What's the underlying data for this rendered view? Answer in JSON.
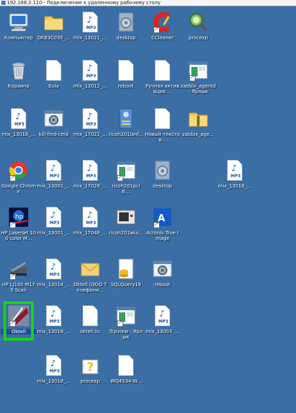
{
  "window": {
    "title": "192.168.2.110 - Подключение к удаленному рабочему столу"
  },
  "desktop": {
    "icons": [
      {
        "label": "Компьютер",
        "type": "computer",
        "col": 0,
        "row": 0
      },
      {
        "label": "OKB3C035_...",
        "type": "folder",
        "col": 1,
        "row": 0
      },
      {
        "label": "mix_13021_...",
        "type": "mp3",
        "col": 2,
        "row": 0
      },
      {
        "label": "desktop",
        "type": "gear",
        "col": 3,
        "row": 0
      },
      {
        "label": "CCleaner",
        "type": "ccleaner",
        "col": 4,
        "row": 0
      },
      {
        "label": "procexp",
        "type": "procexp",
        "col": 5,
        "row": 0
      },
      {
        "label": "Корзина",
        "type": "recycle",
        "col": 0,
        "row": 1
      },
      {
        "label": "Eula",
        "type": "doc",
        "col": 1,
        "row": 1
      },
      {
        "label": "mix_13012_...",
        "type": "mp3",
        "col": 2,
        "row": 1
      },
      {
        "label": "reboot",
        "type": "doc",
        "col": 3,
        "row": 1
      },
      {
        "label": "Ручная активация ...",
        "type": "doc",
        "col": 4,
        "row": 1
      },
      {
        "label": "zabbix_agentd - Ярлык",
        "type": "window",
        "col": 5,
        "row": 1
      },
      {
        "label": "mix_13018_...",
        "type": "mp3",
        "col": 0,
        "row": 2
      },
      {
        "label": "kill-find-cmd",
        "type": "gearwin",
        "col": 1,
        "row": 2
      },
      {
        "label": "mix_17021_...",
        "type": "mp3",
        "col": 2,
        "row": 2
      },
      {
        "label": "ricoh201lanf...",
        "type": "network",
        "col": 3,
        "row": 2
      },
      {
        "label": "Новый текстов...",
        "type": "doc",
        "col": 4,
        "row": 2
      },
      {
        "label": "zabbix_age...",
        "type": "zipfolder",
        "col": 5,
        "row": 2
      },
      {
        "label": "Google Chrome",
        "type": "chrome",
        "col": 0,
        "row": 3
      },
      {
        "label": "mix_13001_...",
        "type": "mp3",
        "col": 1,
        "row": 3
      },
      {
        "label": "mix_17028_...",
        "type": "mp3",
        "col": 2,
        "row": 3
      },
      {
        "label": "ricoh201pcl6...",
        "type": "window",
        "col": 3,
        "row": 3
      },
      {
        "label": "desktop",
        "type": "gear",
        "col": 4,
        "row": 3
      },
      {
        "label": "mix_13018_...",
        "type": "mp3",
        "col": 6,
        "row": 3
      },
      {
        "label": "HP LaserJet 100 color M...",
        "type": "hp",
        "col": 0,
        "row": 4
      },
      {
        "label": "mix_13001_...",
        "type": "mp3",
        "col": 1,
        "row": 4
      },
      {
        "label": "mix_17048_...",
        "type": "mp3",
        "col": 2,
        "row": 4
      },
      {
        "label": "ricoh201wia...",
        "type": "device",
        "col": 3,
        "row": 4
      },
      {
        "label": "Acronis True Image",
        "type": "acronis",
        "col": 4,
        "row": 4
      },
      {
        "label": "HP LJ100 M175 Scan",
        "type": "scanner",
        "col": 0,
        "row": 5
      },
      {
        "label": "mix_13014_...",
        "type": "mp3",
        "col": 1,
        "row": 5
      },
      {
        "label": "Oktell (OOO Телефони...",
        "type": "mail",
        "col": 2,
        "row": 5
      },
      {
        "label": "SQLQuery19",
        "type": "sql",
        "col": 3,
        "row": 5
      },
      {
        "label": "reboot",
        "type": "gearwin",
        "col": 4,
        "row": 5
      },
      {
        "label": "Oktell",
        "type": "oktell",
        "col": 0,
        "row": 6,
        "selected": true
      },
      {
        "label": "mix_13018_...",
        "type": "mp3",
        "col": 1,
        "row": 6
      },
      {
        "label": "oktell.lic",
        "type": "doc",
        "col": 2,
        "row": 6
      },
      {
        "label": "Tcpview - Ярлык",
        "type": "window",
        "col": 3,
        "row": 6
      },
      {
        "label": "mix_13003_...",
        "type": "mp3",
        "col": 4,
        "row": 6
      },
      {
        "label": "mix_13018_...",
        "type": "mp3",
        "col": 1,
        "row": 7
      },
      {
        "label": "procexp",
        "type": "help",
        "col": 2,
        "row": 7
      },
      {
        "label": "WQ4534-W...",
        "type": "doc",
        "col": 3,
        "row": 7
      }
    ],
    "mp3_tag": "MP3"
  }
}
